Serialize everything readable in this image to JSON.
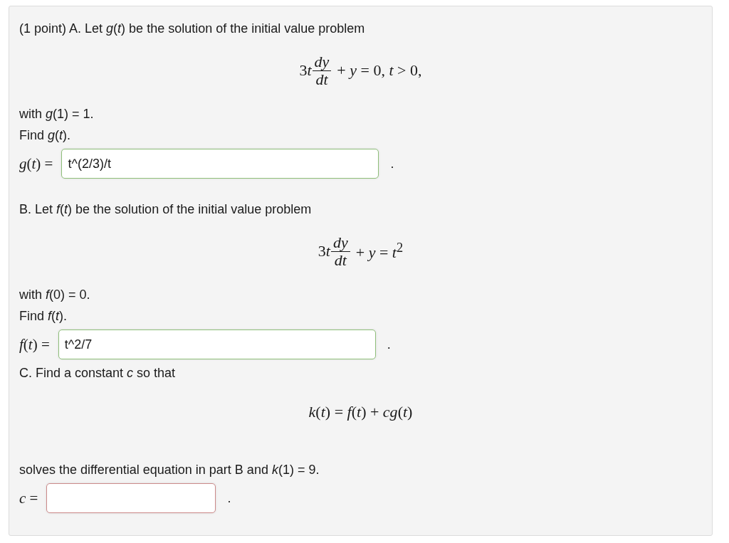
{
  "parts": [
    {
      "intro": "(1 point) A. Let *g*(*t*) be the solution of the initial value problem",
      "equation": {
        "kind": "fraction",
        "coefficient": "3",
        "variable": "t",
        "numerator": "*dy*",
        "denominator": "*dt*",
        "suffix": "+ *y* = 0,  *t* > 0,"
      },
      "lines": [
        "with *g*(1) = 1.",
        "Find *g*(*t*)."
      ],
      "answer": {
        "label": "*g*(*t*) =",
        "value": "t^(2/3)/t",
        "correct": true,
        "trailing": "."
      }
    },
    {
      "intro": "B. Let *f*(*t*) be the solution of the initial value problem",
      "equation": {
        "kind": "fraction",
        "coefficient": "3",
        "variable": "t",
        "numerator": "*dy*",
        "denominator": "*dt*",
        "suffix": "+ *y* = *t*$^{2}$"
      },
      "lines": [
        "with *f*(0) = 0.",
        "Find *f*(*t*)."
      ],
      "answer": {
        "label": "*f*(*t*) =",
        "value": "t^2/7",
        "correct": true,
        "trailing": "."
      }
    },
    {
      "intro": "C. Find a constant *c* so that",
      "equation": {
        "kind": "plain",
        "text": "*k*(*t*) = *f*(*t*) + *cg*(*t*)"
      },
      "lines": [
        "solves the differential equation in part B and *k*(1) = 9."
      ],
      "answer": {
        "label": "*c* =",
        "correct": false,
        "trailing": "."
      }
    }
  ]
}
